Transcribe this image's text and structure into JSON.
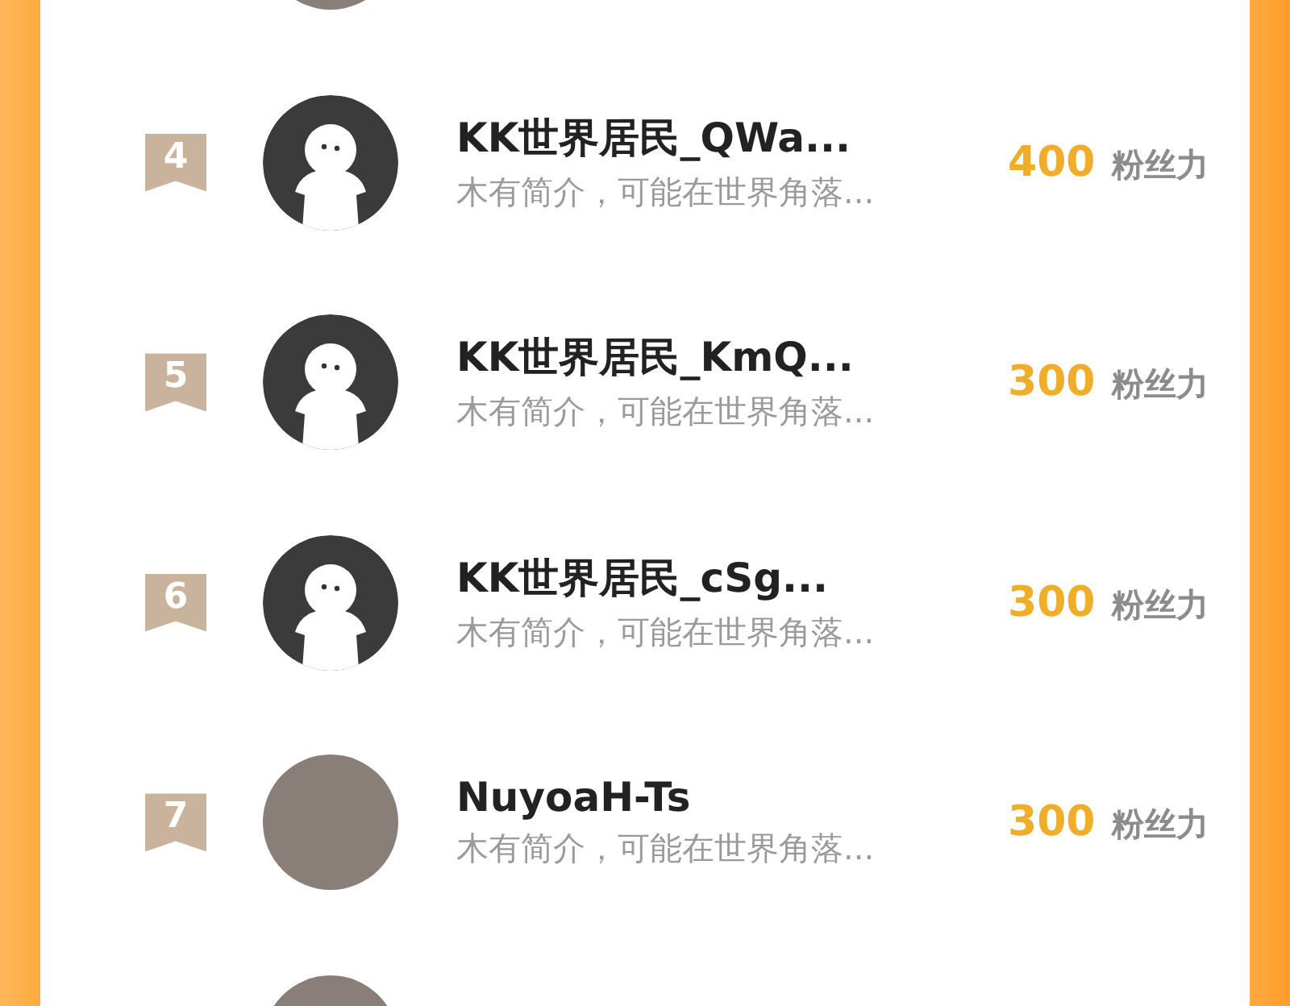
{
  "rows": [
    {
      "avatar": {
        "kind": "photo"
      }
    },
    {
      "rank": "4",
      "avatar": {
        "kind": "default"
      },
      "name": "KK世界居民_QWa...",
      "bio": "木有简介，可能在世界角落...",
      "count": "400",
      "unit": "粉丝力"
    },
    {
      "rank": "5",
      "avatar": {
        "kind": "default"
      },
      "name": "KK世界居民_KmQ...",
      "bio": "木有简介，可能在世界角落...",
      "count": "300",
      "unit": "粉丝力"
    },
    {
      "rank": "6",
      "avatar": {
        "kind": "default"
      },
      "name": "KK世界居民_cSg...",
      "bio": "木有简介，可能在世界角落...",
      "count": "300",
      "unit": "粉丝力"
    },
    {
      "rank": "7",
      "avatar": {
        "kind": "photo"
      },
      "name": "NuyoaH-Ts",
      "bio": "木有简介，可能在世界角落...",
      "count": "300",
      "unit": "粉丝力"
    },
    {
      "avatar": {
        "kind": "photo"
      }
    }
  ]
}
